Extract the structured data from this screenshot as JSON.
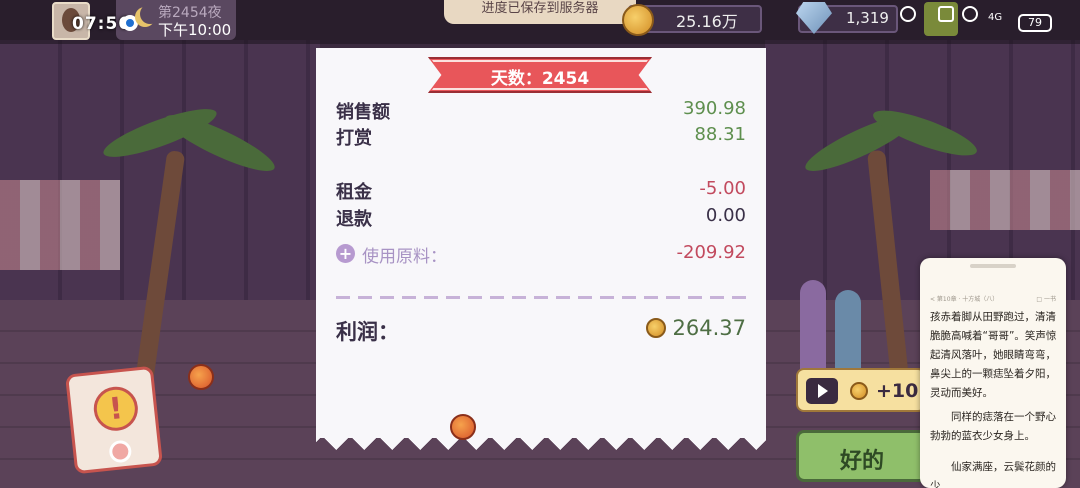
{
  "top_bar": {
    "clock": "07:56",
    "night_label": "第2454夜",
    "time_label": "下午10:00",
    "saved_banner": "进度已保存到服务器",
    "coins": "25.16万",
    "gems": "1,319",
    "battery": "79",
    "signal": "4G"
  },
  "receipt": {
    "day_label": "天数：2454",
    "rows": [
      {
        "label": "销售额",
        "value": "390.98"
      },
      {
        "label": "打赏",
        "value": "88.31"
      },
      {
        "label": "租金",
        "value": "-5.00"
      },
      {
        "label": "退款",
        "value": "0.00"
      }
    ],
    "materials_label": "使用原料：",
    "materials_value": "-209.92",
    "profit_label": "利润：",
    "profit_value": "264.37"
  },
  "actions": {
    "ad_reward": "+10",
    "ok_label": "好的"
  },
  "reader": {
    "header_left": "< 第10章 · 十方城（八）",
    "header_right": "□ 一书",
    "p1": "孩赤着脚从田野跑过，清清脆脆高喊着“哥哥”。笑声惊起清风落叶，她眼睛弯弯，鼻尖上的一颗痣坠着夕阳，灵动而美好。",
    "p2": "同样的痣落在一个野心勃勃的蓝衣少女身上。",
    "p3": "仙家满座，云鬓花颜的少"
  },
  "colors": {
    "profit_green": "#4e6e44",
    "income_green": "#5e8f4e",
    "expense_red": "#c24a5e",
    "ribbon_red": "#e8565a",
    "ok_green": "#8fbf6a"
  }
}
